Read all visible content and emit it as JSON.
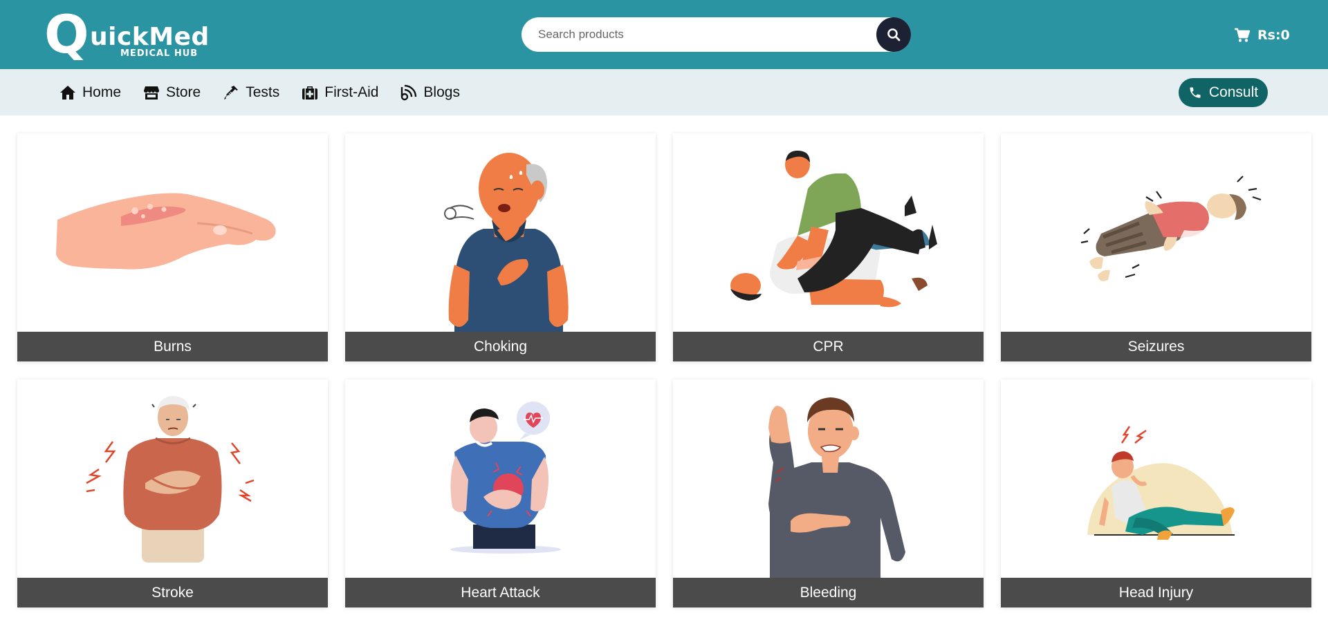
{
  "brand": {
    "logo_big_letter": "Q",
    "logo_word": "uickMed",
    "logo_subtitle": "MEDICAL HUB"
  },
  "search": {
    "placeholder": "Search products",
    "value": ""
  },
  "cart": {
    "icon": "cart-icon",
    "amount": "Rs:0"
  },
  "nav": {
    "items": [
      {
        "label": "Home",
        "icon": "home-icon"
      },
      {
        "label": "Store",
        "icon": "store-icon"
      },
      {
        "label": "Tests",
        "icon": "syringe-icon"
      },
      {
        "label": "First-Aid",
        "icon": "first-aid-kit-icon"
      },
      {
        "label": "Blogs",
        "icon": "blog-feed-icon"
      }
    ],
    "consult_label": "Consult",
    "consult_icon": "phone-icon"
  },
  "cards": [
    {
      "title": "Burns"
    },
    {
      "title": "Choking"
    },
    {
      "title": "CPR"
    },
    {
      "title": "Seizures"
    },
    {
      "title": "Stroke"
    },
    {
      "title": "Heart Attack"
    },
    {
      "title": "Bleeding"
    },
    {
      "title": "Head Injury"
    }
  ],
  "colors": {
    "header": "#2b94a2",
    "navbar": "#e5eff2",
    "consult": "#116466",
    "caption": "#4b4b4b",
    "search_button": "#1c2233"
  }
}
